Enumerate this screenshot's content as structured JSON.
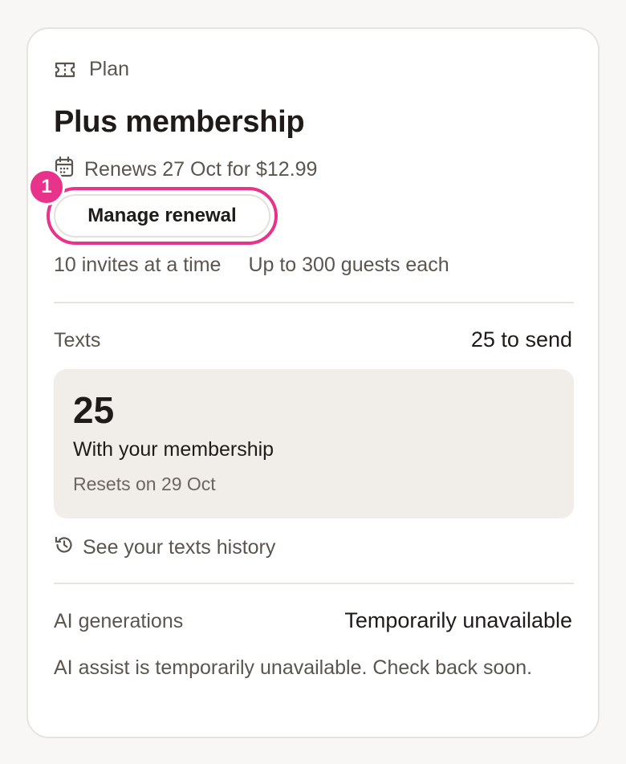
{
  "plan": {
    "section_label": "Plan",
    "title": "Plus membership",
    "renews_text": "Renews 27 Oct for $12.99",
    "manage_label": "Manage renewal",
    "step_badge": "1",
    "features": [
      "10 invites at a time",
      "Up to 300 guests each"
    ]
  },
  "texts": {
    "label": "Texts",
    "value": "25 to send",
    "count": "25",
    "caption": "With your membership",
    "reset": "Resets on 29 Oct",
    "history_link": "See your texts history"
  },
  "ai": {
    "label": "AI generations",
    "value": "Temporarily unavailable",
    "note": "AI assist is temporarily unavailable. Check back soon."
  },
  "colors": {
    "highlight": "#e8338b",
    "surface": "#f1eeea",
    "muted_text": "#5b5550"
  }
}
